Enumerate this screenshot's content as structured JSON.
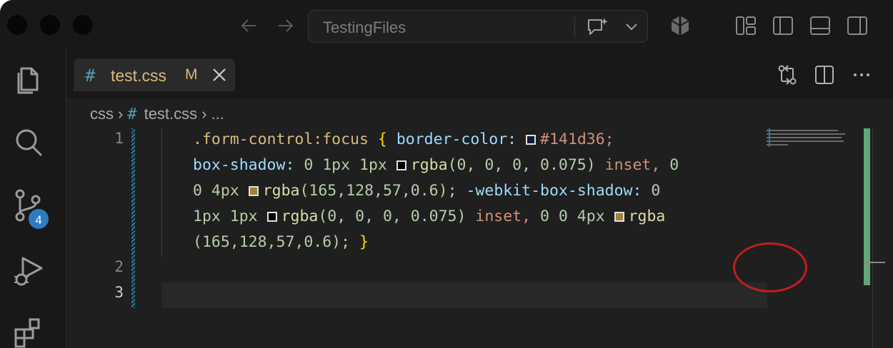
{
  "titlebar": {
    "search_title": "TestingFiles"
  },
  "activity": {
    "scm_badge": "4"
  },
  "tab": {
    "hash": "#",
    "filename": "test.css",
    "modified": "M"
  },
  "breadcrumb": {
    "folder": "css",
    "hash": "#",
    "file": "test.css",
    "more": "..."
  },
  "line_numbers": [
    "1",
    "2",
    "3"
  ],
  "code": {
    "l1_sel": ".form-control:focus",
    "l1_brace": "{",
    "l1_prop": "border-color:",
    "l1_val": "#141d36;",
    "l2_prop": "box-shadow:",
    "l2_nums": "0 1px 1px",
    "l2_fn": "rgba",
    "l2_args": "(0, 0, 0, 0.075)",
    "l2_kw": "inset,",
    "l2_tail": "0",
    "l3_head": "0 4px",
    "l3_fn": "rgba",
    "l3_args": "(165,128,57,0.6);",
    "l3_prop": "-webkit-box-shadow:",
    "l3_tail": "0",
    "l4_head": "1px 1px",
    "l4_fn": "rgba",
    "l4_args": "(0, 0, 0, 0.075)",
    "l4_kw": "inset,",
    "l4_mid": "0 0 4px",
    "l4_fn2": "rgba",
    "l5_args": "(165,128,57,0.6);",
    "l5_brace": "}"
  },
  "colors": {
    "swatch_navy": "#141d36",
    "swatch_black": "#000000",
    "swatch_gold": "#a58039",
    "annotation": "#c21d1d"
  },
  "icons": [
    "back-arrow-icon",
    "forward-arrow-icon",
    "copilot-chat-icon",
    "chevron-down-icon",
    "copilot-logo-icon",
    "customize-layout-icon",
    "toggle-primary-sidebar-icon",
    "toggle-panel-icon",
    "toggle-secondary-sidebar-icon",
    "explorer-icon",
    "search-icon",
    "source-control-icon",
    "run-debug-icon",
    "extensions-icon",
    "compare-changes-icon",
    "split-editor-icon",
    "more-actions-icon",
    "close-icon"
  ]
}
